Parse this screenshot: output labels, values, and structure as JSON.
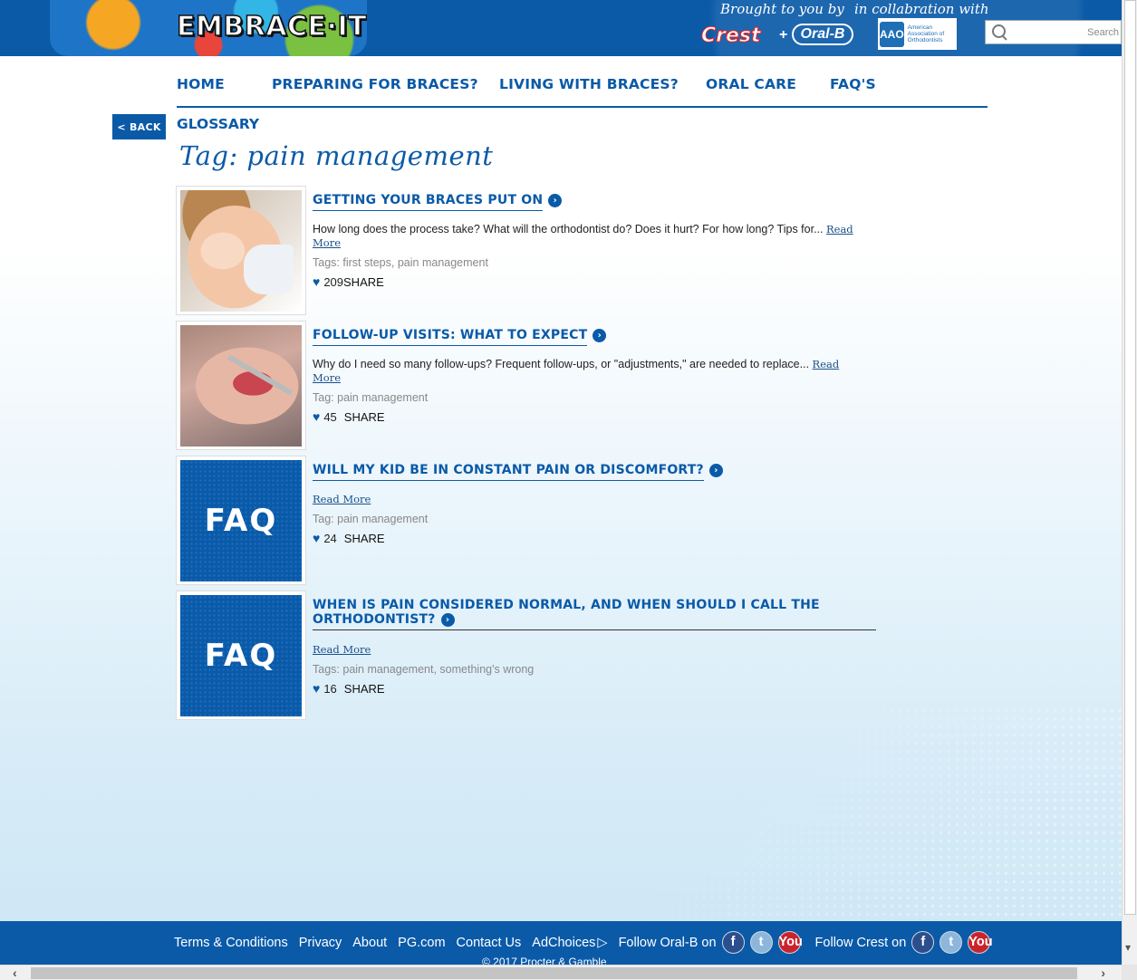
{
  "header": {
    "logo_text": "EMBRACE·IT!",
    "brought_by": "Brought to you by",
    "collab": "in collabration with",
    "crest": "Crest",
    "plus": "+",
    "oralb": "Oral-B",
    "aao_mark": "AAO",
    "aao_text": "American Association of Orthodontists",
    "search_placeholder": "Search"
  },
  "nav": {
    "items": [
      "HOME",
      "PREPARING FOR BRACES?",
      "LIVING WITH BRACES?",
      "ORAL CARE",
      "FAQ'S"
    ],
    "glossary": "GLOSSARY"
  },
  "back_label": "< BACK",
  "page_title": "Tag: pain management",
  "articles": [
    {
      "title": "GETTING YOUR BRACES PUT ON",
      "excerpt": "How long does the process take? What will the orthodontist do? Does it hurt? For how long? Tips for...",
      "read_more_a": "Read",
      "read_more_b": "More",
      "tags_label": "Tags:",
      "tag1": "first steps",
      "sep": ",",
      "tag2": "pain management",
      "likes": "209",
      "share": "SHARE"
    },
    {
      "title": "FOLLOW-UP VISITS: WHAT TO EXPECT",
      "excerpt": "Why do I need so many follow-ups? Frequent follow-ups, or \"adjustments,\" are needed to replace...",
      "read_more_a": "Read",
      "read_more_b": "More",
      "tags_label": "Tag:",
      "tag1": "pain management",
      "likes": "45",
      "share": "SHARE"
    },
    {
      "title": "WILL MY KID BE IN CONSTANT PAIN OR DISCOMFORT?",
      "read_more": "Read More",
      "tags_label": "Tag:",
      "tag1": "pain management",
      "likes": "24",
      "share": "SHARE",
      "image_text": "FAQ"
    },
    {
      "title": "WHEN IS PAIN CONSIDERED NORMAL, AND WHEN SHOULD I CALL THE ORTHODONTIST?",
      "read_more": "Read More",
      "tags_label": "Tags:",
      "tag1": "pain management",
      "sep": ",",
      "tag2": "something's wrong",
      "likes": "16",
      "share": "SHARE",
      "image_text": "FAQ"
    }
  ],
  "footer": {
    "terms": "Terms & Conditions",
    "privacy": "Privacy",
    "about": "About",
    "pg": "PG.com",
    "contact": "Contact Us",
    "adchoices": "AdChoices",
    "follow_oralb": "Follow Oral-B on",
    "follow_crest": "Follow Crest on",
    "copyright": "© 2017 Procter & Gamble"
  },
  "icons": {
    "chevron": "chevron-right-circle-icon",
    "heart": "heart-icon",
    "search": "search-icon"
  },
  "colors": {
    "brand_blue": "#0a5aa8"
  }
}
